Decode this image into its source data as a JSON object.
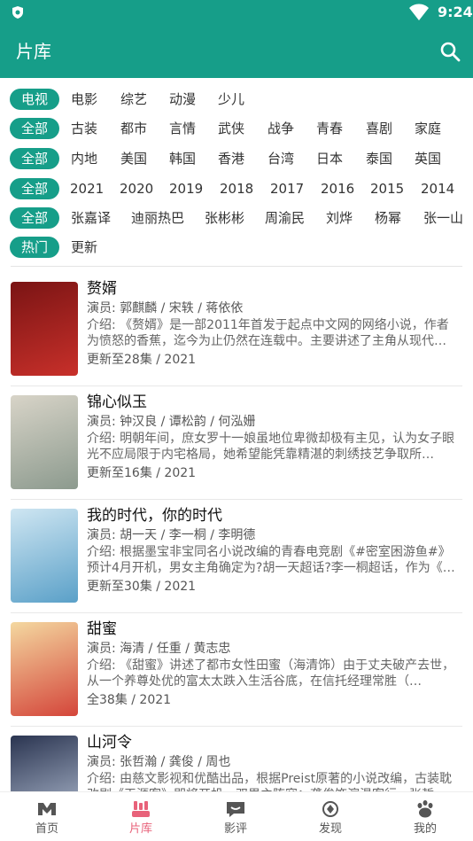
{
  "status_bar": {
    "time": "9:24"
  },
  "app_bar": {
    "title": "片库",
    "search_icon": "search-icon"
  },
  "filters": {
    "rows": [
      {
        "selected": "电视",
        "options": [
          "电影",
          "综艺",
          "动漫",
          "少儿"
        ]
      },
      {
        "selected": "全部",
        "options": [
          "古装",
          "都市",
          "言情",
          "武侠",
          "战争",
          "青春",
          "喜剧",
          "家庭"
        ]
      },
      {
        "selected": "全部",
        "options": [
          "内地",
          "美国",
          "韩国",
          "香港",
          "台湾",
          "日本",
          "泰国",
          "英国"
        ]
      },
      {
        "selected": "全部",
        "options": [
          "2021",
          "2020",
          "2019",
          "2018",
          "2017",
          "2016",
          "2015",
          "2014"
        ]
      },
      {
        "selected": "全部",
        "options": [
          "张嘉译",
          "迪丽热巴",
          "张彬彬",
          "周渝民",
          "刘烨",
          "杨幂",
          "张一山"
        ]
      },
      {
        "selected": "热门",
        "options": [
          "更新"
        ]
      }
    ]
  },
  "shows": [
    {
      "title": "赘婿",
      "cast": "演员: 郭麒麟 / 宋轶 / 蒋依依",
      "intro": "介绍: 《赘婿》是一部2011年首发于起点中文网的网络小说，作者为愤怒的香蕉，迄今为止仍然在连载中。主要讲述了主角从现代…",
      "status": "更新至28集 / 2021",
      "poster_colors": [
        "#7a1414",
        "#c8302a"
      ]
    },
    {
      "title": "锦心似玉",
      "cast": "演员: 钟汉良 / 谭松韵 / 何泓姗",
      "intro": "介绍: 明朝年间，庶女罗十一娘虽地位卑微却极有主见，认为女子眼光不应局限于内宅格局，她希望能凭靠精湛的刺绣技艺争取所…",
      "status": "更新至16集 / 2021",
      "poster_colors": [
        "#d8d4c8",
        "#8c9a8e"
      ]
    },
    {
      "title": "我的时代，你的时代",
      "cast": "演员: 胡一天 / 李一桐 / 李明德",
      "intro": "介绍: 根据墨宝非宝同名小说改编的青春电竞剧《#密室困游鱼#》预计4月开机，男女主角确定为?胡一天超话?李一桐超话，作为《…",
      "status": "更新至30集 / 2021",
      "poster_colors": [
        "#cfe6f2",
        "#5aa0c8"
      ]
    },
    {
      "title": "甜蜜",
      "cast": "演员: 海清 / 任重 / 黄志忠",
      "intro": "介绍: 《甜蜜》讲述了都市女性田蜜（海清饰）由于丈夫破产去世，从一个养尊处优的富太太跌入生活谷底，在信托经理常胜（…",
      "status": "全38集 / 2021",
      "poster_colors": [
        "#f4d8a0",
        "#d4453a"
      ]
    },
    {
      "title": "山河令",
      "cast": "演员: 张哲瀚 / 龚俊 / 周也",
      "intro": "介绍: 由慈文影视和优酷出品，根据Preist原著的小说改编，古装耽改剧《天涯客》即将开机，双男主阵容：龚俊饰演温客行，张哲…",
      "status": "",
      "poster_colors": [
        "#2a3450",
        "#b8c4d8"
      ]
    }
  ],
  "tabs": [
    {
      "label": "首页",
      "icon": "home-m-icon"
    },
    {
      "label": "片库",
      "icon": "library-icon"
    },
    {
      "label": "影评",
      "icon": "review-icon"
    },
    {
      "label": "发现",
      "icon": "discover-icon"
    },
    {
      "label": "我的",
      "icon": "paw-profile-icon"
    }
  ],
  "colors": {
    "primary": "#169e89",
    "active_tab": "#e8627a"
  }
}
